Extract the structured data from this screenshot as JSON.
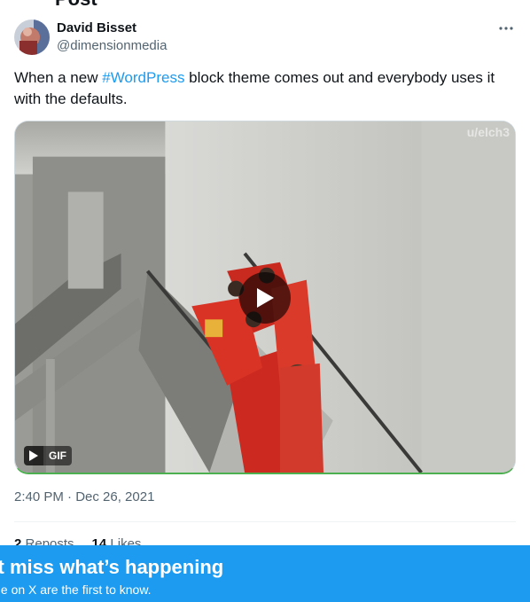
{
  "page": {
    "header_title": "Post"
  },
  "author": {
    "display_name": "David Bisset",
    "handle": "@dimensionmedia"
  },
  "tweet": {
    "text_before": "When a new ",
    "hashtag": "#WordPress",
    "text_after": " block theme comes out and everybody uses it with the defaults.",
    "timestamp": "2:40 PM · Dec 26, 2021"
  },
  "media": {
    "type_badge": "GIF",
    "watermark": "u/elch3",
    "icons": [
      "play-icon",
      "gif-play-icon"
    ]
  },
  "stats": {
    "reposts_count": "2",
    "reposts_label": "Reposts",
    "likes_count": "14",
    "likes_label": "Likes"
  },
  "banner": {
    "title": "n’t miss what’s happening",
    "subtitle": "ple on X are the first to know."
  },
  "colors": {
    "accent": "#1d9bf0",
    "text": "#0f1419",
    "secondary_text": "#536471"
  }
}
